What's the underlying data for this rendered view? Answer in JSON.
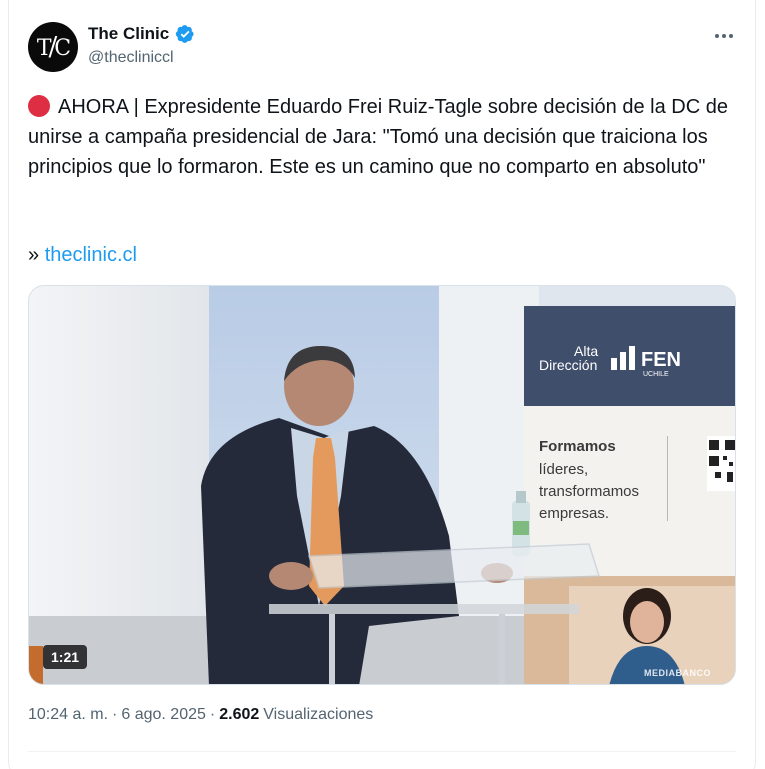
{
  "account": {
    "display_name": "The Clinic",
    "handle": "@theclinicc​l",
    "avatar_text": "T/C",
    "verified": true
  },
  "tweet": {
    "emoji_icon": "red-circle",
    "body": "AHORA | Expresidente Eduardo Frei Ruiz-Tagle sobre decisión de la DC de unirse a campaña presidencial de Jara: \"Tomó una decisión que traiciona los principios que lo formaron. Este es un camino que no comparto en absoluto\"",
    "link_prefix": "» ",
    "link_text": "theclinic.cl"
  },
  "media": {
    "duration": "1:21",
    "watermark": "MEDIABANCO",
    "banner": {
      "brand_line1": "Alta",
      "brand_line2": "Dirección",
      "brand_logo": "FEN",
      "brand_sub": "UCHILE",
      "slogan_line1": "Formamos",
      "slogan_line2": "líderes,",
      "slogan_line3": "transformamos",
      "slogan_line4": "empresas."
    }
  },
  "meta": {
    "time": "10:24 a. m.",
    "separator": "·",
    "date": "6 ago. 2025",
    "views_count": "2.602",
    "views_label": "Visualizaciones"
  },
  "colors": {
    "accent": "#1d9bf0",
    "text": "#0f1419",
    "secondary": "#536471",
    "red_dot": "#dd2e44"
  }
}
